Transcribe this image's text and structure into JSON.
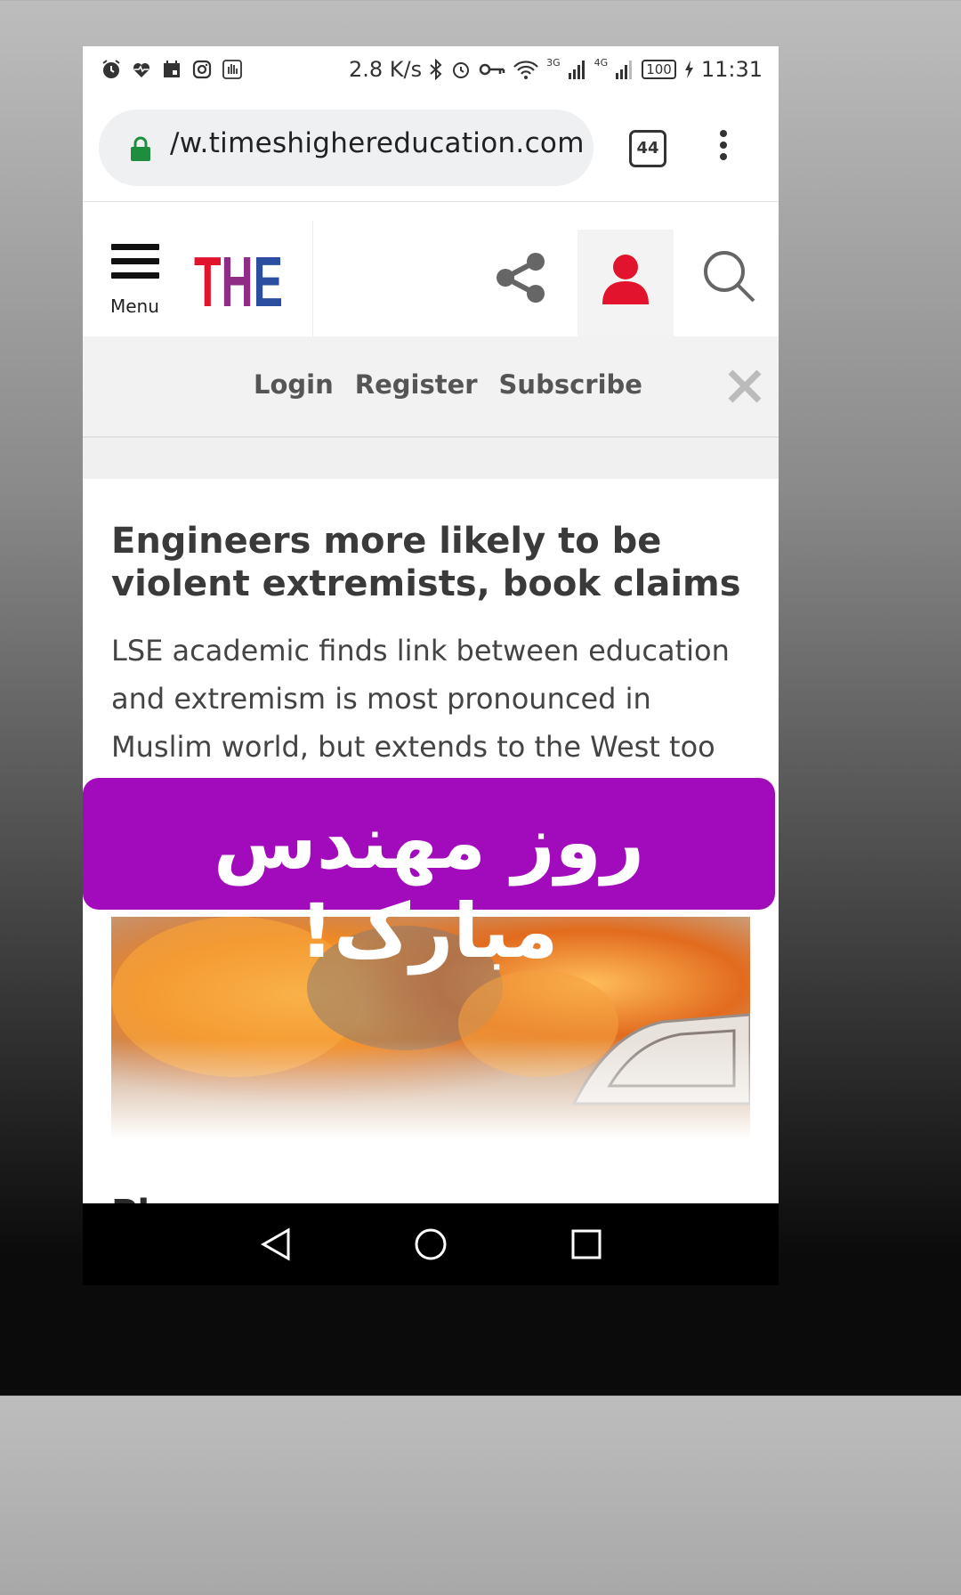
{
  "status_bar": {
    "left_icons": [
      "alarm-icon",
      "heart-pulse-icon",
      "calendar-icon",
      "instagram-icon",
      "hand-icon"
    ],
    "net_speed": "2.8 K/s",
    "signal_3g": "3G",
    "signal_4g": "4G",
    "battery": "100",
    "time": "11:31"
  },
  "browser": {
    "url": "/w.timeshighereducation.com",
    "tab_count": "44"
  },
  "site_header": {
    "menu_label": "Menu",
    "logo_text": "THE",
    "logo_colors": [
      "#e2142d",
      "#8e2c86",
      "#2c4ea1"
    ]
  },
  "login_bar": {
    "login": "Login",
    "register": "Register",
    "subscribe": "Subscribe"
  },
  "article": {
    "headline": "Engineers more likely to be violent extremists, book claims",
    "standfirst": "LSE academic finds link between education and extremism is most pronounced in Muslim world, but extends to the West too",
    "next_headline_partial": "Pl"
  },
  "overlay": {
    "banner_text": "روز مهندس مبارک!",
    "banner_color": "#a20bbb"
  },
  "navigation": {
    "buttons": [
      "back-icon",
      "home-icon",
      "recents-icon"
    ]
  }
}
